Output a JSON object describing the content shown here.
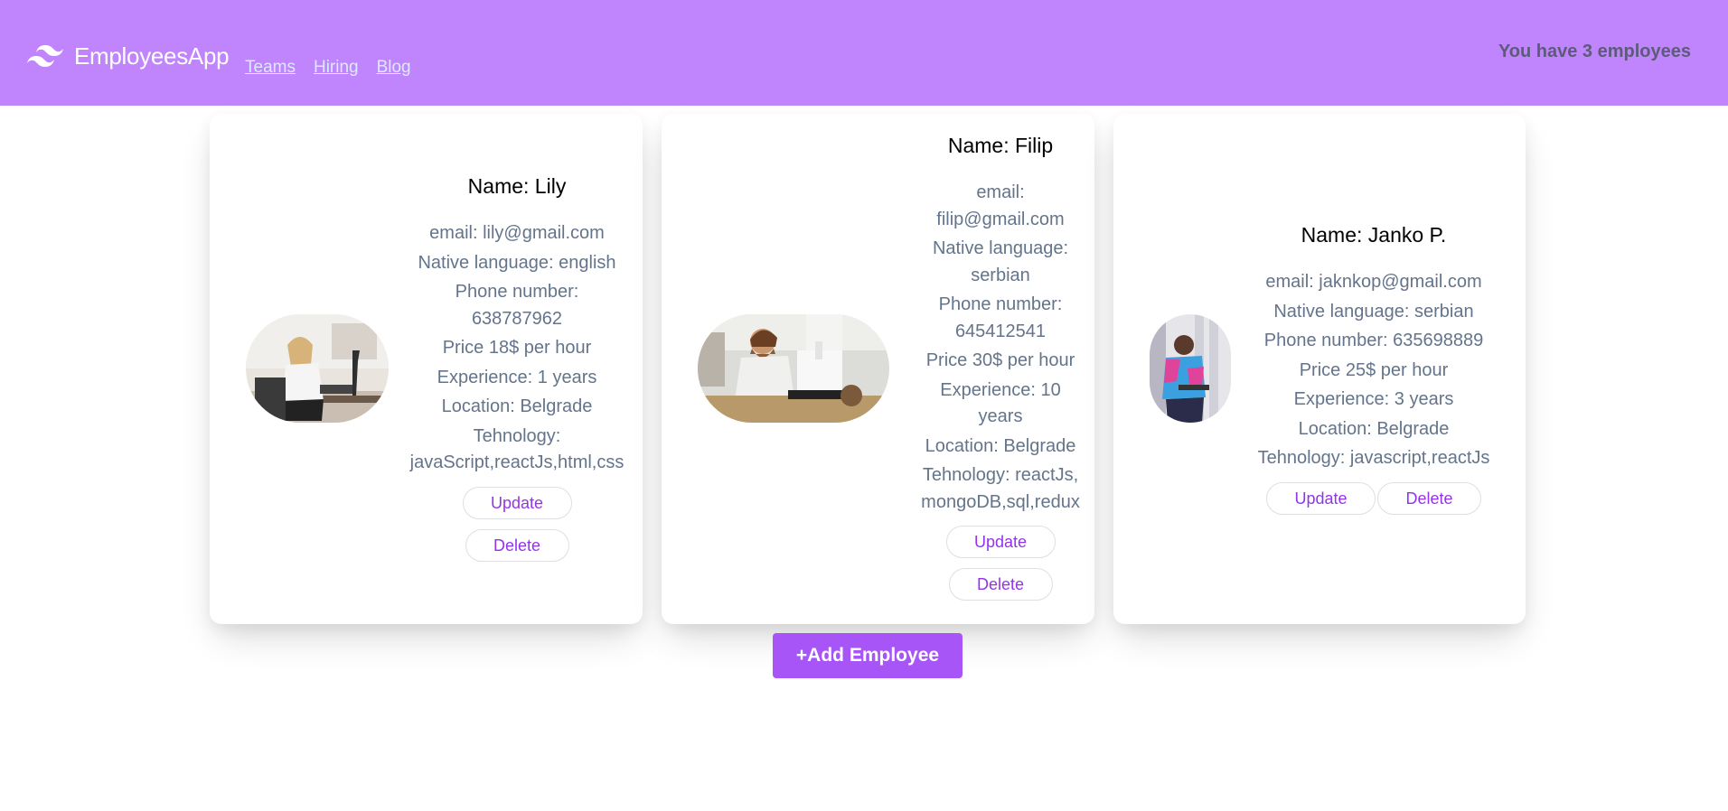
{
  "app": {
    "brand": "EmployeesApp",
    "nav": [
      "Teams",
      "Hiring",
      "Blog"
    ],
    "employee_count_text": "You have 3 employees"
  },
  "colors": {
    "navbar": "#c084fc",
    "accent": "#a855f7",
    "button_text": "#9333ea",
    "muted_text": "#64748b"
  },
  "employees": [
    {
      "name": "Name: Lily",
      "email": "email: lily@gmail.com",
      "language": "Native language: english",
      "phone_label": "Phone number:",
      "phone": "638787962",
      "price": "Price 18$ per hour",
      "experience": "Experience: 1 years",
      "location": "Location: Belgrade",
      "tech_label": "Tehnology:",
      "tech": "javaScript,reactJs,html,css",
      "photo_alt": "woman working on laptop"
    },
    {
      "name": "Name: Filip",
      "email_label": "email:",
      "email": "filip@gmail.com",
      "language_label": "Native language:",
      "language": "serbian",
      "phone_label": "Phone number:",
      "phone": "645412541",
      "price": "Price 30$ per hour",
      "experience_label": "Experience: 10",
      "experience": "years",
      "location": "Location: Belgrade",
      "tech_label": "Tehnology: reactJs,",
      "tech": "mongoDB,sql,redux",
      "photo_alt": "man working at desk"
    },
    {
      "name": "Name: Janko P.",
      "email": "email: jaknkop@gmail.com",
      "language": "Native language: serbian",
      "phone": "Phone number: 635698889",
      "price": "Price 25$ per hour",
      "experience": "Experience: 3 years",
      "location": "Location: Belgrade",
      "tech": "Tehnology: javascript,reactJs",
      "photo_alt": "man with laptop"
    }
  ],
  "buttons": {
    "update": "Update",
    "delete": "Delete",
    "add": "+Add Employee"
  },
  "icons": {
    "brand_logo": "tailwind-wave-icon"
  }
}
